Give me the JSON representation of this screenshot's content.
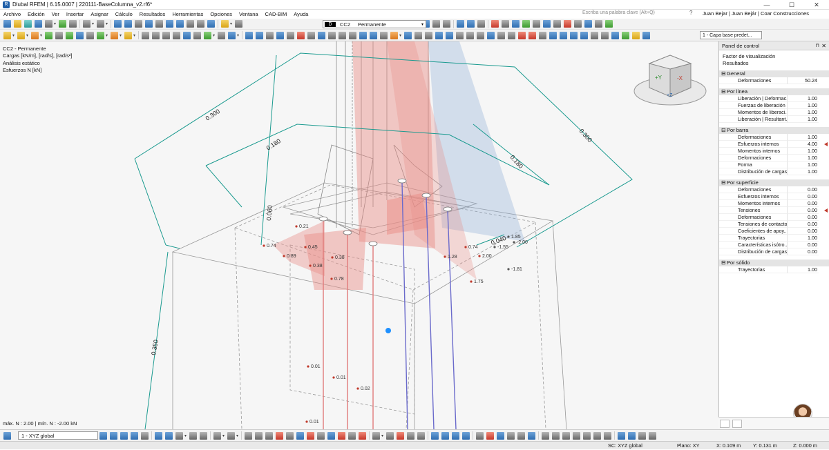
{
  "window": {
    "title": "Dlubal RFEM | 6.15.0007 | 220111-BaseColumna_v2.rf6*",
    "minimize": "—",
    "maximize": "☐",
    "close": "✕"
  },
  "menu": {
    "items": [
      "Archivo",
      "Edición",
      "Ver",
      "Insertar",
      "Asignar",
      "Cálculo",
      "Resultados",
      "Herramientas",
      "Opciones",
      "Ventana",
      "CAD-BIM",
      "Ayuda"
    ],
    "search_placeholder": "Escriba una palabra clave (Alt+Q)",
    "user": "Juan Bejar | Juan Bejár | Coar Construcciones",
    "help_icon": "?"
  },
  "load_case": {
    "badge": "D",
    "id": "CC2",
    "name": "Permanente"
  },
  "layer": {
    "name": "1 - Capa base predet..."
  },
  "viewport_info": [
    "CC2 - Permanente",
    "Cargas [kN/m], [rad/s], [rad/s²]",
    "Análisis estático",
    "Esfuerzos N [kN]"
  ],
  "viewport_footer": "máx. N : 2.00 | mín. N : -2.00 kN",
  "dimensions": [
    "0.300",
    "0.180",
    "0.300",
    "0.180",
    "0.060",
    "0.040",
    "0.350"
  ],
  "result_labels": [
    "0.21",
    "0.45",
    "0.74",
    "0.89",
    "0.38",
    "0.38",
    "0.78",
    "0.74",
    "1.28",
    "2.00",
    "1.75",
    "-1.55",
    "1.85",
    "-2.00",
    "-1.81",
    "0.01",
    "0.01",
    "0.02",
    "0.01"
  ],
  "navcube": {
    "faces": [
      "+Y",
      "-X",
      "+Z"
    ]
  },
  "panel": {
    "title": "Panel de control",
    "pin": "⊓",
    "close": "✕",
    "subtitle": [
      "Factor de visualización",
      "Resultados"
    ],
    "sections": [
      {
        "name": "General",
        "rows": [
          {
            "label": "Deformaciones",
            "value": "50.24"
          }
        ]
      },
      {
        "name": "Por línea",
        "rows": [
          {
            "label": "Liberación | Deformac...",
            "value": "1.00"
          },
          {
            "label": "Fuerzas de liberación",
            "value": "1.00"
          },
          {
            "label": "Momentos de liberaci...",
            "value": "1.00"
          },
          {
            "label": "Liberación | Resultant...",
            "value": "1.00"
          }
        ]
      },
      {
        "name": "Por barra",
        "rows": [
          {
            "label": "Deformaciones",
            "value": "1.00"
          },
          {
            "label": "Esfuerzos internos",
            "value": "4.00",
            "marked": true
          },
          {
            "label": "Momentos internos",
            "value": "1.00"
          },
          {
            "label": "Deformaciones",
            "value": "1.00"
          },
          {
            "label": "Forma",
            "value": "1.00"
          },
          {
            "label": "Distribución de cargas",
            "value": "1.00"
          }
        ]
      },
      {
        "name": "Por superficie",
        "rows": [
          {
            "label": "Deformaciones",
            "value": "0.00"
          },
          {
            "label": "Esfuerzos internos",
            "value": "0.00"
          },
          {
            "label": "Momentos internos",
            "value": "0.00"
          },
          {
            "label": "Tensiones",
            "value": "0.00",
            "marked": true
          },
          {
            "label": "Deformaciones",
            "value": "0.00"
          },
          {
            "label": "Tensiones de contacto",
            "value": "0.00"
          },
          {
            "label": "Coeficientes de apoy...",
            "value": "0.00"
          },
          {
            "label": "Trayectorias",
            "value": "1.00"
          },
          {
            "label": "Características isótro...",
            "value": "0.00"
          },
          {
            "label": "Distribución de cargas",
            "value": "0.00"
          }
        ]
      },
      {
        "name": "Por sólido",
        "rows": [
          {
            "label": "Trayectorias",
            "value": "1.00"
          }
        ]
      }
    ]
  },
  "coord_system": "1 - XYZ global",
  "status": {
    "sc": "SC: XYZ global",
    "plane": "Plano: XY",
    "x": "X: 0.109 m",
    "y": "Y: 0.131 m",
    "z": "Z: 0.000 m"
  }
}
